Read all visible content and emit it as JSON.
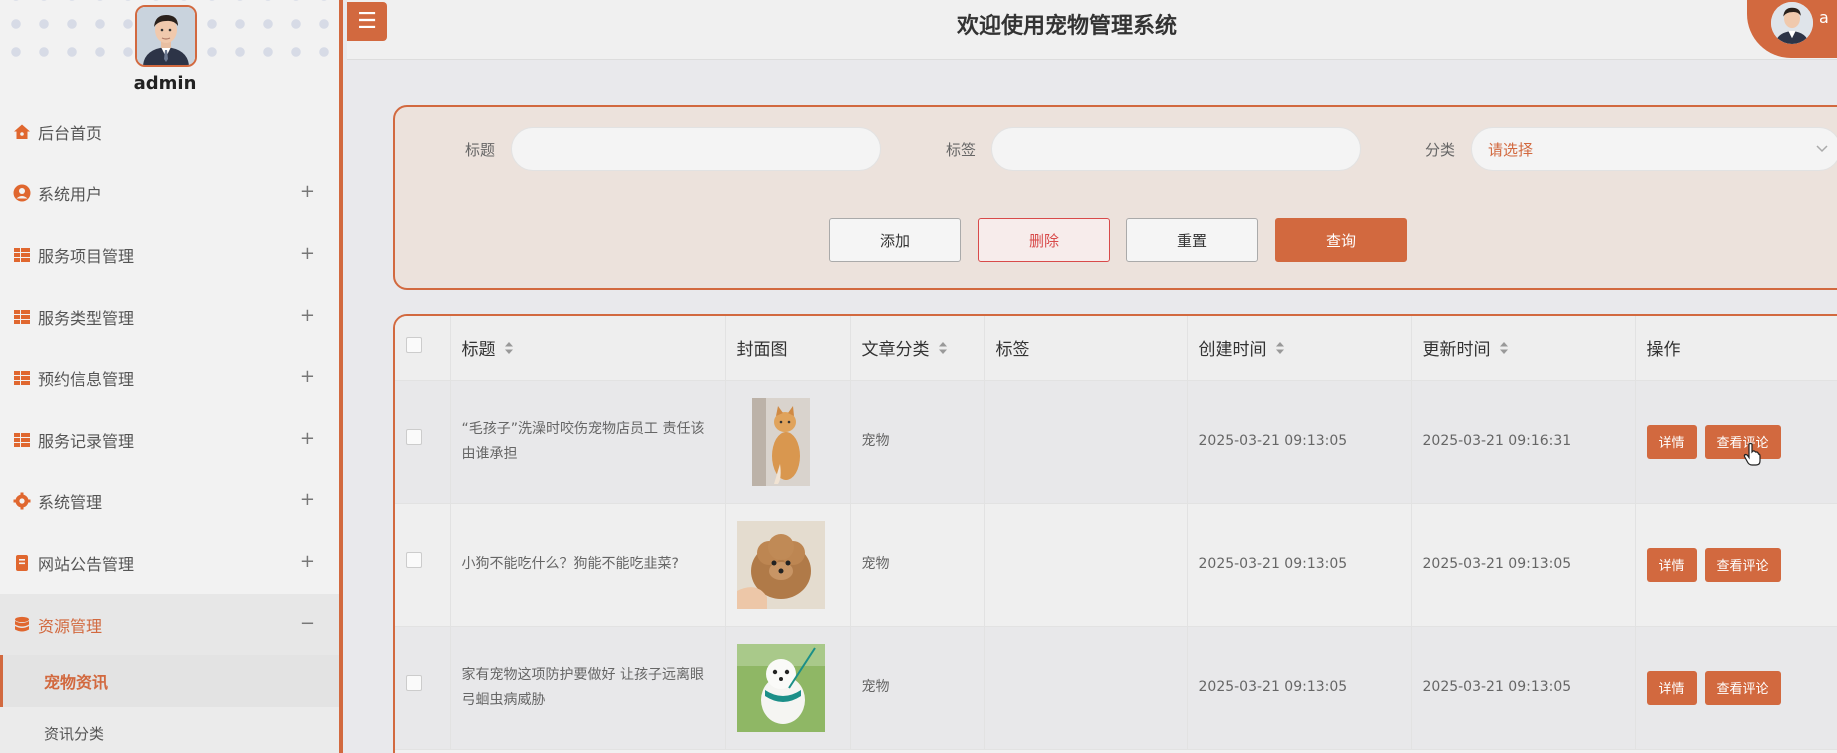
{
  "header": {
    "title": "欢迎使用宠物管理系统",
    "menu_toggle": "☰",
    "username": "a"
  },
  "user": {
    "name": "admin"
  },
  "sidebar": {
    "items": [
      {
        "label": "后台首页",
        "icon": "home-icon",
        "expandable": false
      },
      {
        "label": "系统用户",
        "icon": "user-icon",
        "expandable": true,
        "toggle": "+"
      },
      {
        "label": "服务项目管理",
        "icon": "grid-icon",
        "expandable": true,
        "toggle": "+"
      },
      {
        "label": "服务类型管理",
        "icon": "grid-icon",
        "expandable": true,
        "toggle": "+"
      },
      {
        "label": "预约信息管理",
        "icon": "grid-icon",
        "expandable": true,
        "toggle": "+"
      },
      {
        "label": "服务记录管理",
        "icon": "grid-icon",
        "expandable": true,
        "toggle": "+"
      },
      {
        "label": "系统管理",
        "icon": "gear-icon",
        "expandable": true,
        "toggle": "+"
      },
      {
        "label": "网站公告管理",
        "icon": "document-icon",
        "expandable": true,
        "toggle": "+"
      },
      {
        "label": "资源管理",
        "icon": "database-icon",
        "expandable": true,
        "toggle": "−",
        "active": true
      }
    ],
    "subitems": [
      {
        "label": "宠物资讯",
        "active": true
      },
      {
        "label": "资讯分类",
        "active": false
      }
    ]
  },
  "search": {
    "title_label": "标题",
    "title_value": "",
    "tag_label": "标签",
    "tag_value": "",
    "category_label": "分类",
    "category_placeholder": "请选择",
    "buttons": {
      "add": "添加",
      "delete": "删除",
      "reset": "重置",
      "query": "查询"
    }
  },
  "table": {
    "columns": {
      "title": "标题",
      "cover": "封面图",
      "category": "文章分类",
      "tags": "标签",
      "created": "创建时间",
      "updated": "更新时间",
      "actions": "操作"
    },
    "action_labels": {
      "detail": "详情",
      "comments": "查看评论"
    },
    "rows": [
      {
        "title": "“毛孩子”洗澡时咬伤宠物店员工 责任该由谁承担",
        "cover": "cat-photo",
        "category": "宠物",
        "tags": "",
        "created": "2025-03-21 09:13:05",
        "updated": "2025-03-21 09:16:31"
      },
      {
        "title": "小狗不能吃什么？狗能不能吃韭菜?",
        "cover": "poodle-photo",
        "category": "宠物",
        "tags": "",
        "created": "2025-03-21 09:13:05",
        "updated": "2025-03-21 09:13:05"
      },
      {
        "title": "家有宠物这项防护要做好 让孩子远离眼弓蛔虫病威胁",
        "cover": "white-dog-photo",
        "category": "宠物",
        "tags": "",
        "created": "2025-03-21 09:13:05",
        "updated": "2025-03-21 09:13:05"
      }
    ]
  },
  "colors": {
    "accent": "#d2693f",
    "danger": "#d84a4a",
    "sidebar_bg": "#f2f2f2",
    "page_bg": "#e9e9ec"
  }
}
